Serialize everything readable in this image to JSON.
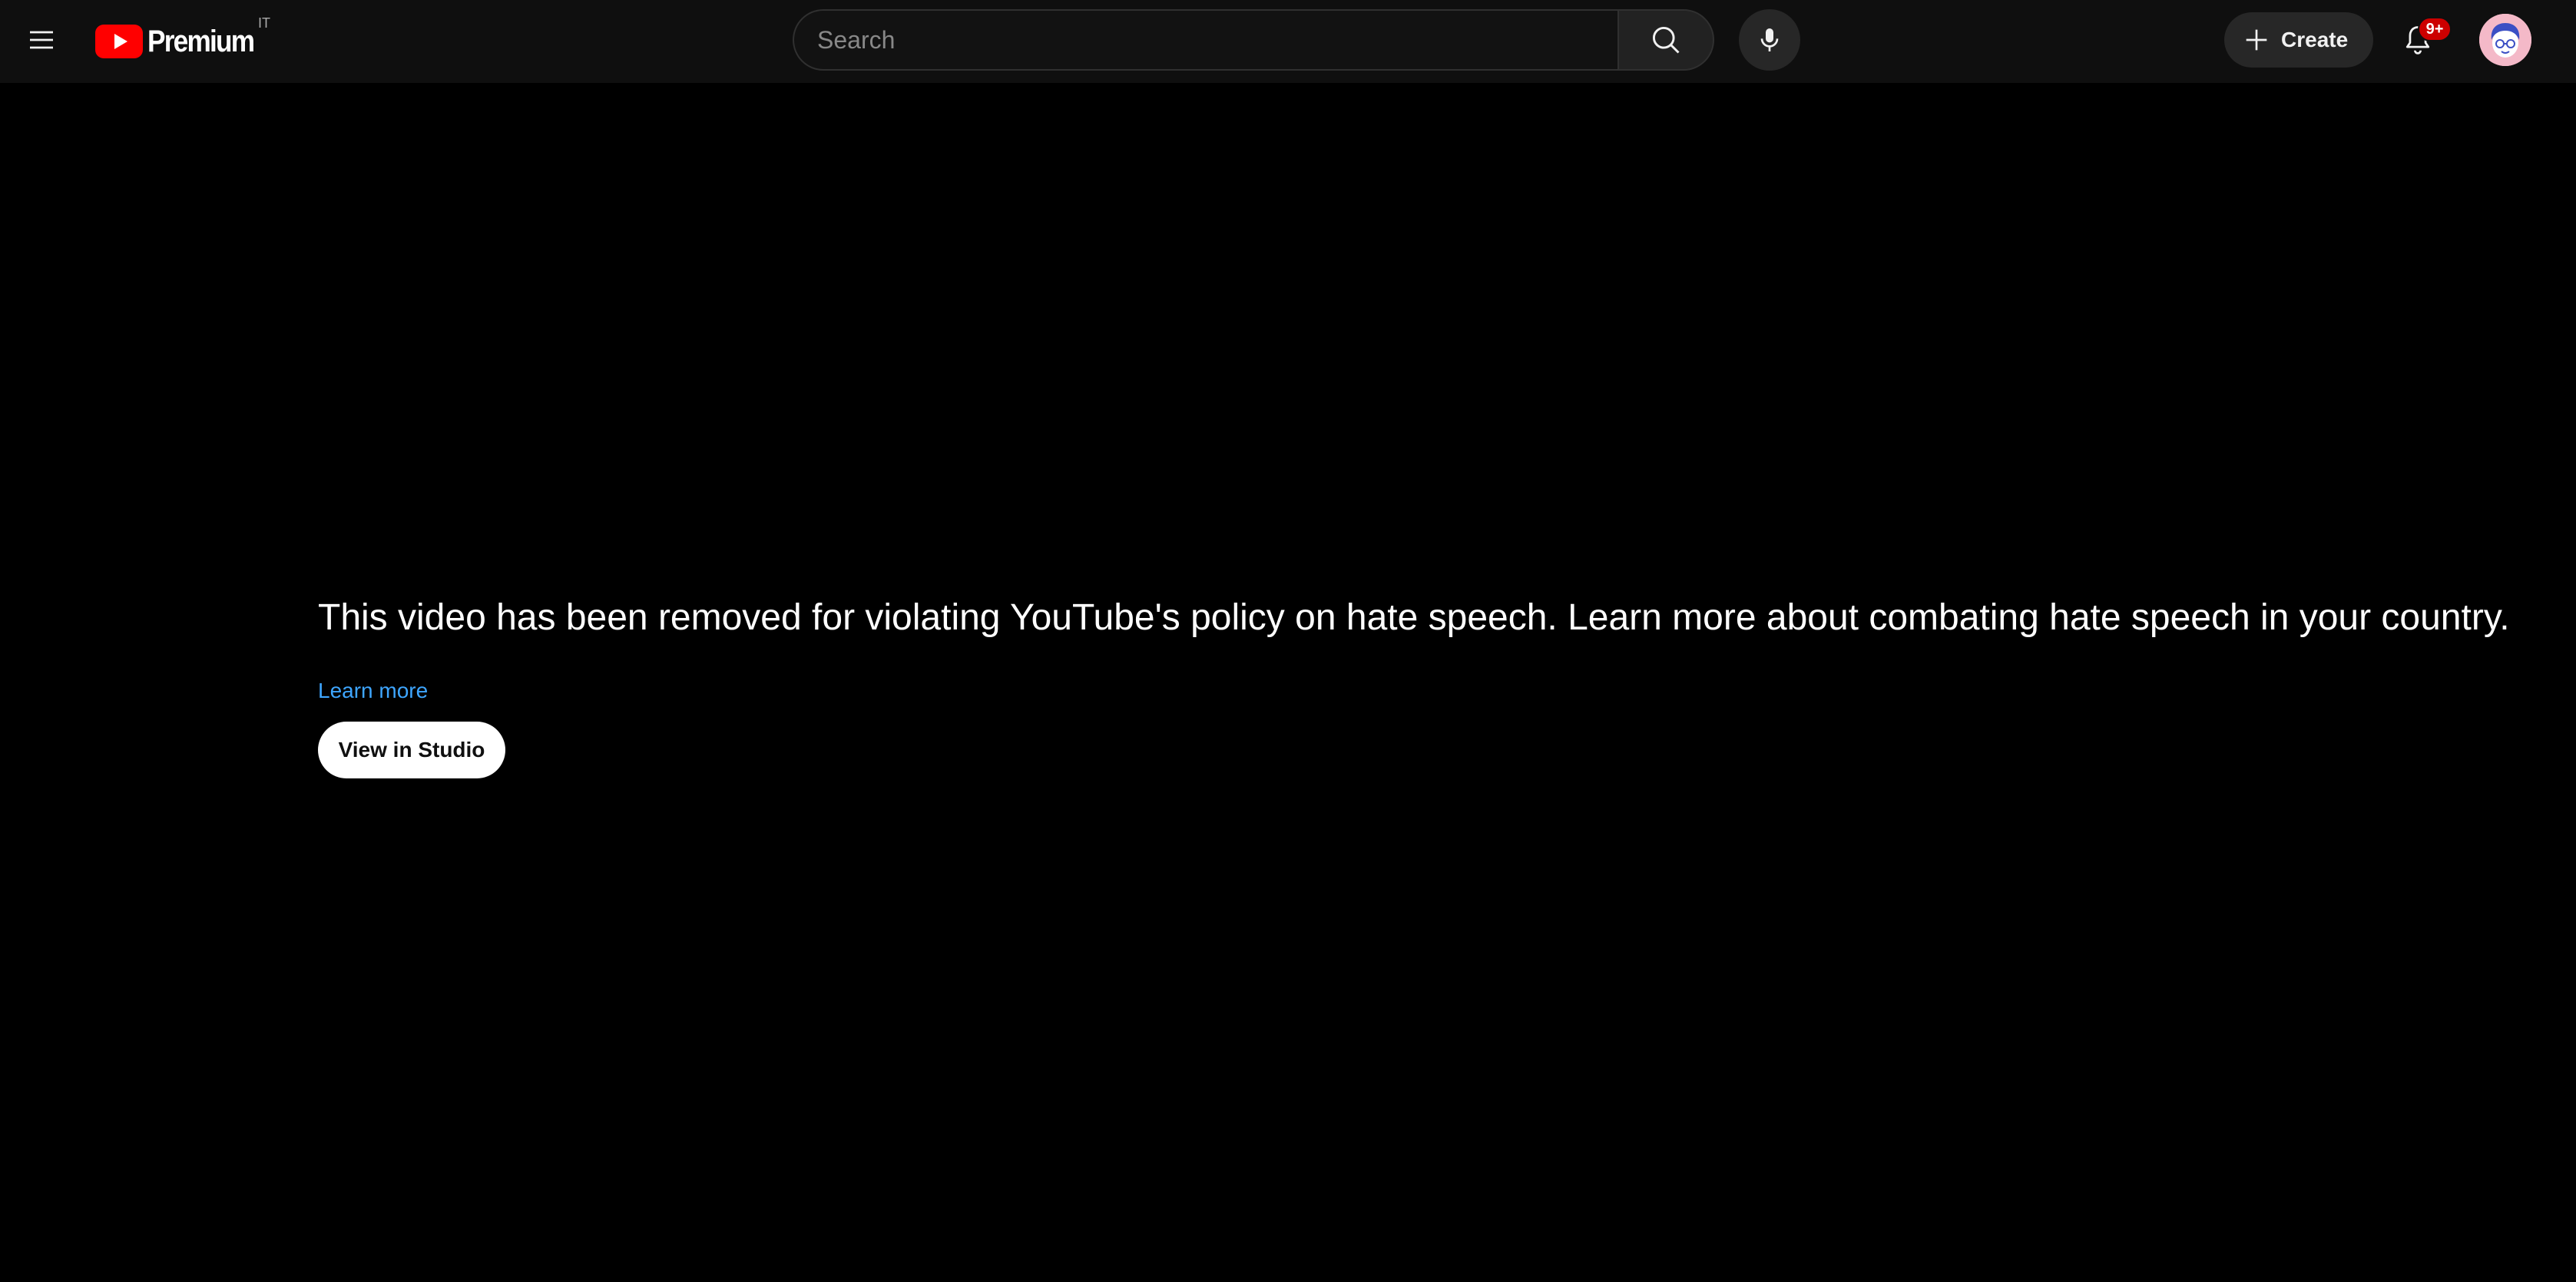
{
  "header": {
    "logo_text": "Premium",
    "country_code": "IT",
    "search": {
      "placeholder": "Search",
      "value": ""
    },
    "create_label": "Create",
    "notification_count": "9+"
  },
  "icons": {
    "menu": "hamburger-menu-icon",
    "logo": "youtube-logo-icon",
    "search": "search-icon",
    "mic": "microphone-icon",
    "create": "plus-icon",
    "bell": "bell-icon",
    "avatar": "user-avatar"
  },
  "colors": {
    "background": "#000000",
    "header": "#0f0f0f",
    "brand_red": "#ff0000",
    "link": "#3ea6ff",
    "badge": "#cc0000"
  },
  "main": {
    "message": "This video has been removed for violating YouTube's policy on hate speech. Learn more about combating hate speech in your country.",
    "learn_more_label": "Learn more",
    "studio_button_label": "View in Studio"
  }
}
